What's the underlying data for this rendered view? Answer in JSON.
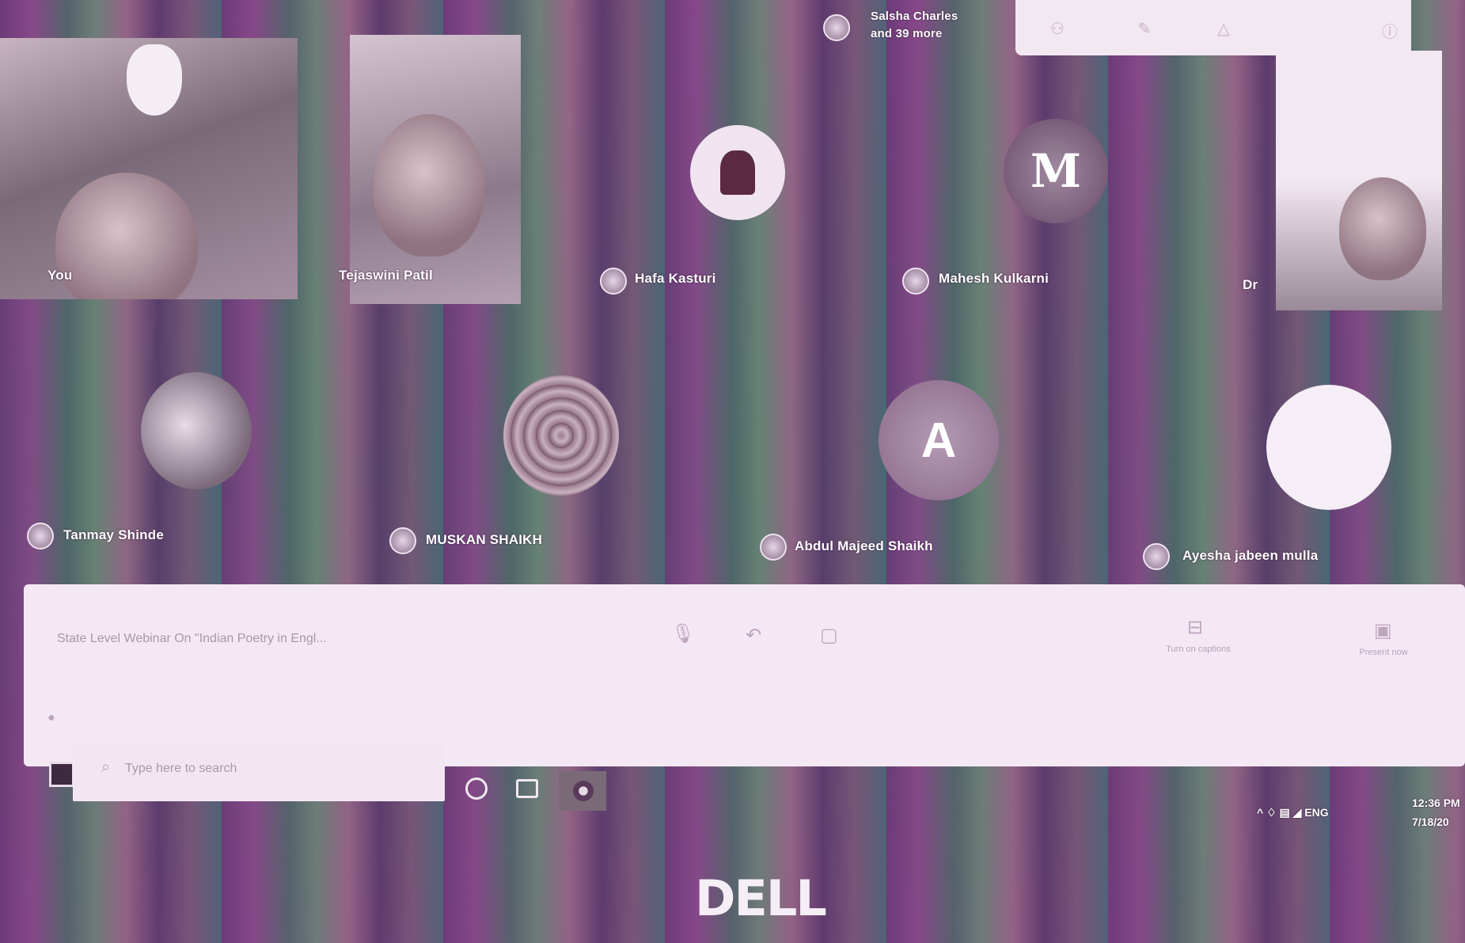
{
  "meeting": {
    "top_participants": {
      "label_line1": "Salsha Charles",
      "label_line2": "and 39 more"
    },
    "tiles_row1": [
      {
        "name": "You",
        "type": "video"
      },
      {
        "name": "Tejaswini Patil",
        "type": "video"
      },
      {
        "name": "Hafa Kasturi",
        "type": "avatar-photo"
      },
      {
        "name": "Mahesh Kulkarni",
        "type": "avatar-letter",
        "letter": "M"
      },
      {
        "name": "Dr",
        "type": "video"
      }
    ],
    "tiles_row2": [
      {
        "name": "Tanmay Shinde",
        "type": "avatar-photo"
      },
      {
        "name": "MUSKAN SHAIKH",
        "type": "avatar-pattern"
      },
      {
        "name": "Abdul Majeed Shaikh",
        "type": "avatar-letter",
        "letter": "A"
      },
      {
        "name": "Ayesha jabeen mulla",
        "type": "avatar-photo"
      }
    ]
  },
  "meeting_bar": {
    "title": "State Level Webinar On \"Indian Poetry in Engl...",
    "captions_label": "Turn on captions",
    "present_label": "Present now"
  },
  "taskbar": {
    "search_placeholder": "Type here to search",
    "tray_time": "12:36 PM",
    "tray_date": "7/18/20"
  },
  "brand": {
    "logo_text": "DELL"
  },
  "colors": {
    "band_purple": "#6b3a78",
    "band_teal": "#4f6a6a",
    "panel_bg": "#f5e8f5"
  }
}
